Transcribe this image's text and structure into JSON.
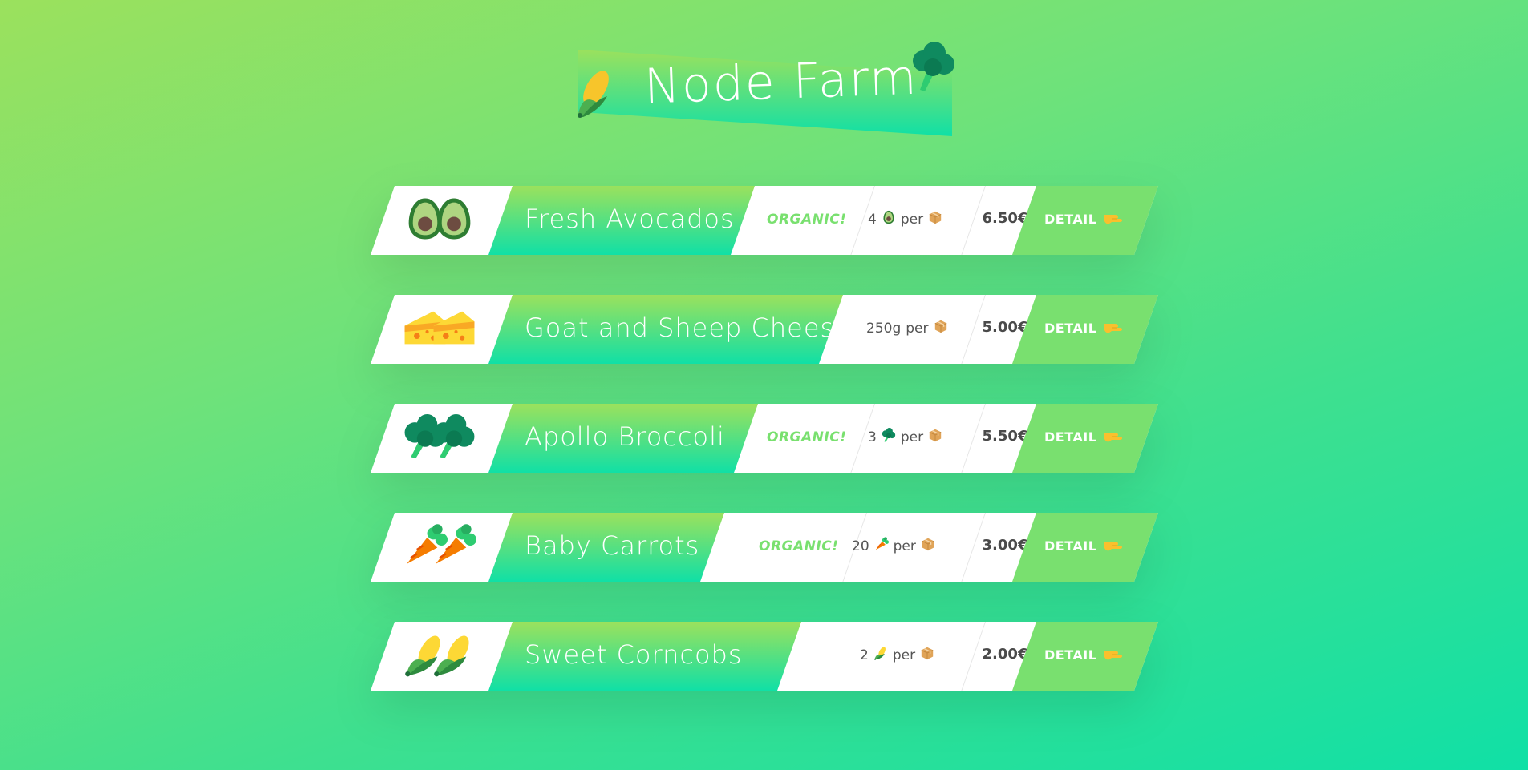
{
  "header": {
    "title": "Node Farm",
    "left_icon": "corn-icon",
    "right_icon": "broccoli-icon"
  },
  "colors": {
    "gradient_start": "#9be15d",
    "gradient_end": "#10e0a6",
    "organic_text": "#79e06f",
    "detail_button": "#79e06f",
    "price_text": "#4a4a4a"
  },
  "products": [
    {
      "emoji": "avocado-icon",
      "name": "Fresh Avocados",
      "organic": "ORGANIC!",
      "quantity": "4",
      "unit_icon": "avocado-icon",
      "per": "per",
      "per_icon": "box-icon",
      "price": "6.50€",
      "detail": "DETAIL",
      "detail_icon": "pointing-hand-icon"
    },
    {
      "emoji": "cheese-icon",
      "name": "Goat and Sheep Cheese",
      "organic": "",
      "quantity": "250g",
      "unit_icon": "",
      "per": "per",
      "per_icon": "box-icon",
      "price": "5.00€",
      "detail": "DETAIL",
      "detail_icon": "pointing-hand-icon"
    },
    {
      "emoji": "broccoli-icon",
      "name": "Apollo Broccoli",
      "organic": "ORGANIC!",
      "quantity": "3",
      "unit_icon": "broccoli-icon",
      "per": "per",
      "per_icon": "box-icon",
      "price": "5.50€",
      "detail": "DETAIL",
      "detail_icon": "pointing-hand-icon"
    },
    {
      "emoji": "carrot-icon",
      "name": "Baby Carrots",
      "organic": "ORGANIC!",
      "quantity": "20",
      "unit_icon": "carrot-icon",
      "per": "per",
      "per_icon": "box-icon",
      "price": "3.00€",
      "detail": "DETAIL",
      "detail_icon": "pointing-hand-icon"
    },
    {
      "emoji": "corn-icon",
      "name": "Sweet Corncobs",
      "organic": "",
      "quantity": "2",
      "unit_icon": "corn-icon",
      "per": "per",
      "per_icon": "box-icon",
      "price": "2.00€",
      "detail": "DETAIL",
      "detail_icon": "pointing-hand-icon"
    }
  ]
}
